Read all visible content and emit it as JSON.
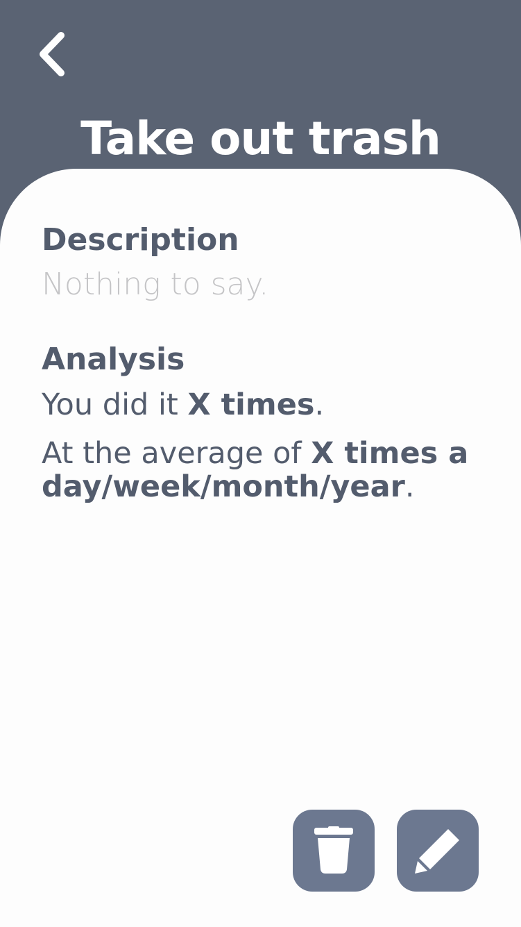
{
  "header": {
    "title": "Take out trash",
    "back_icon": "chevron-left-icon"
  },
  "description": {
    "heading": "Description",
    "text": "Nothing to say."
  },
  "analysis": {
    "heading": "Analysis",
    "line1_prefix": "You did it ",
    "line1_count": "X times",
    "line1_suffix": ".",
    "line2_prefix": "At the average of ",
    "line2_rate": "X times a day/week/month/year",
    "line2_suffix": "."
  },
  "actions": {
    "delete_icon": "trash-icon",
    "edit_icon": "pencil-icon"
  },
  "colors": {
    "header_bg": "#5a6373",
    "card_bg": "#fdfdfd",
    "text_primary": "#535c6d",
    "text_muted": "#c4c4c6",
    "button_bg": "#6c7890"
  }
}
